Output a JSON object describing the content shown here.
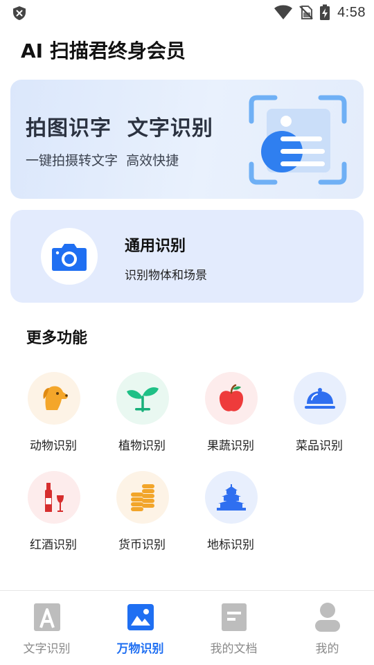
{
  "status_bar": {
    "time": "4:58",
    "icons": [
      "shield-icon",
      "wifi-icon",
      "no-sim-icon",
      "battery-charging-icon"
    ]
  },
  "page": {
    "title": "AI 扫描君终身会员"
  },
  "banner": {
    "title": "拍图识字  文字识别",
    "subtitle": "一键拍摄转文字  高效快捷",
    "icon": "document-scan-icon"
  },
  "general_recognition": {
    "title": "通用识别",
    "subtitle": "识别物体和场景",
    "icon": "camera-icon",
    "accent": "#1f6ff2"
  },
  "more_features": {
    "title": "更多功能",
    "items": [
      {
        "label": "动物识别",
        "icon": "dog-icon",
        "bg": "#fdf3e6"
      },
      {
        "label": "植物识别",
        "icon": "sprout-icon",
        "bg": "#e9f8f1"
      },
      {
        "label": "果蔬识别",
        "icon": "apple-icon",
        "bg": "#fdecec"
      },
      {
        "label": "菜品识别",
        "icon": "food-cloche-icon",
        "bg": "#e8effd"
      },
      {
        "label": "红酒识别",
        "icon": "wine-icon",
        "bg": "#fdecec"
      },
      {
        "label": "货币识别",
        "icon": "coins-icon",
        "bg": "#fdf3e6"
      },
      {
        "label": "地标识别",
        "icon": "temple-landmark-icon",
        "bg": "#e8effd"
      }
    ]
  },
  "tab_bar": {
    "active_color": "#1f6ff2",
    "tabs": [
      {
        "label": "文字识别",
        "icon": "text-a-icon",
        "active": false
      },
      {
        "label": "万物识别",
        "icon": "image-icon",
        "active": true
      },
      {
        "label": "我的文档",
        "icon": "document-icon",
        "active": false
      },
      {
        "label": "我的",
        "icon": "person-icon",
        "active": false
      }
    ]
  }
}
